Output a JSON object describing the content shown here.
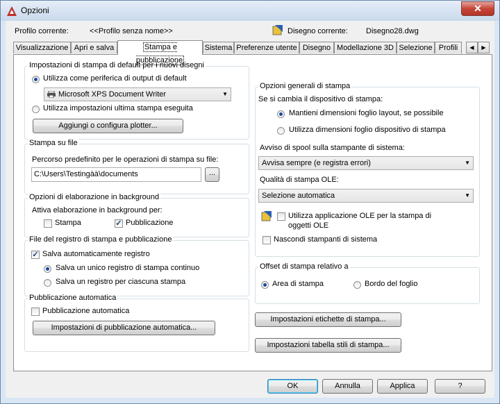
{
  "window": {
    "title": "Opzioni",
    "close_glyph": "✕"
  },
  "header": {
    "profile_label": "Profilo corrente:",
    "profile_value": "<<Profilo senza nome>>",
    "drawing_label": "Disegno corrente:",
    "drawing_value": "Disegno28.dwg"
  },
  "tabs": [
    "Visualizzazione",
    "Apri e salva",
    "Stampa e pubblicazione",
    "Sistema",
    "Preferenze utente",
    "Disegno",
    "Modellazione 3D",
    "Selezione",
    "Profili"
  ],
  "tab_scroll": {
    "left": "◀",
    "right": "▶"
  },
  "default_print": {
    "title": "Impostazioni di stampa di default per i nuovi disegni",
    "use_device_label": "Utilizza come periferica di output di default",
    "device_value": "Microsoft XPS Document Writer",
    "use_last_label": "Utilizza impostazioni ultima stampa eseguita",
    "add_plotter_button": "Aggiungi o configura plotter..."
  },
  "print_to_file": {
    "title": "Stampa su file",
    "path_label": "Percorso predefinito per le operazioni di stampa su file:",
    "path_value": "C:\\Users\\Testingàà\\documents",
    "browse_button": "..."
  },
  "background": {
    "title": "Opzioni di elaborazione in background",
    "enable_label": "Attiva elaborazione in background per:",
    "print_label": "Stampa",
    "publish_label": "Pubblicazione"
  },
  "log_file": {
    "title": "File del registro di stampa e pubblicazione",
    "autosave_label": "Salva automaticamente registro",
    "continuous_label": "Salva un unico registro di stampa continuo",
    "per_print_label": "Salva un registro per ciascuna stampa"
  },
  "auto_publish": {
    "title": "Pubblicazione automatica",
    "checkbox_label": "Pubblicazione automatica",
    "settings_button": "Impostazioni di pubblicazione automatica..."
  },
  "general_options": {
    "title": "Opzioni generali di stampa",
    "device_change_label": "Se si cambia il dispositivo di stampa:",
    "keep_layout_label": "Mantieni dimensioni foglio layout, se possibile",
    "use_device_paper_label": "Utilizza dimensioni foglio dispositivo di stampa",
    "spool_label": "Avviso di spool sulla stampante di sistema:",
    "spool_value": "Avvisa sempre (e registra errori)",
    "ole_quality_label": "Qualità di stampa OLE:",
    "ole_quality_value": "Selezione automatica",
    "use_ole_app_label_1": "Utilizza applicazione OLE per la stampa di",
    "use_ole_app_label_2": "oggetti OLE",
    "hide_printers_label": "Nascondi stampanti di sistema"
  },
  "offset": {
    "title": "Offset di stampa relativo a",
    "printable_area_label": "Area di stampa",
    "paper_edge_label": "Bordo del foglio"
  },
  "buttons": {
    "stamp_settings": "Impostazioni etichette di stampa...",
    "style_table_settings": "Impostazioni tabella stili di stampa...",
    "ok": "OK",
    "cancel": "Annulla",
    "apply": "Applica",
    "help": "?"
  },
  "colors": {
    "title_icon": "#c0302a",
    "accent": "#1a4aa0"
  }
}
